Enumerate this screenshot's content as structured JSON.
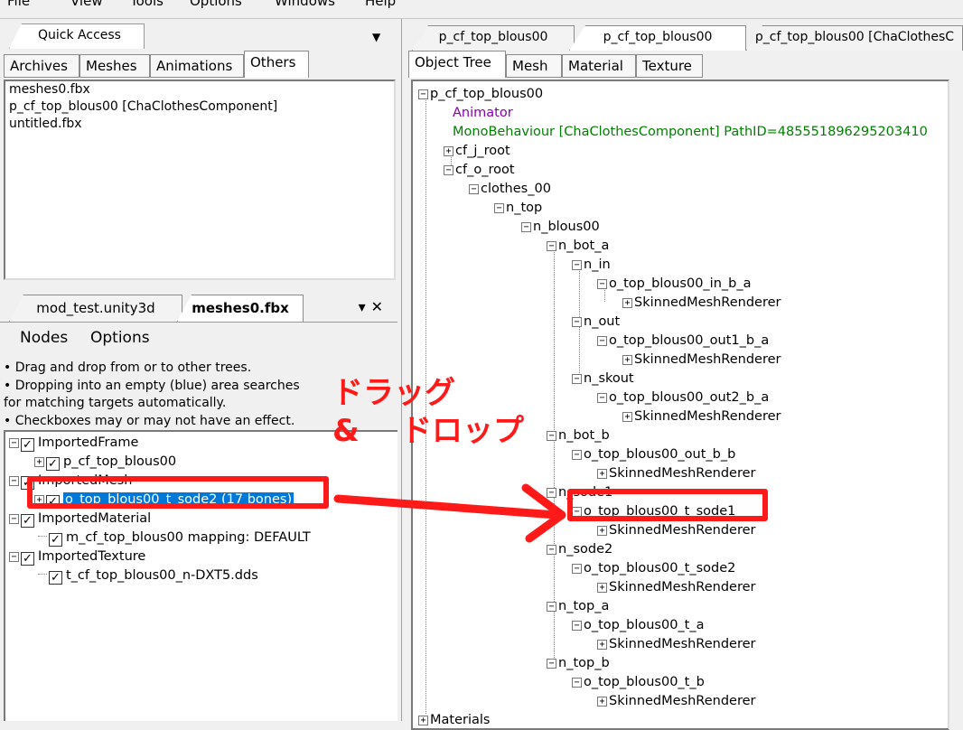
{
  "menu": {
    "file": "File",
    "view": "View",
    "tools": "Tools",
    "options": "Options",
    "windows": "Windows",
    "help": "Help"
  },
  "quick_access": {
    "title": "Quick Access",
    "tabs": [
      "Archives",
      "Meshes",
      "Animations",
      "Others"
    ],
    "items": [
      "meshes0.fbx",
      "p_cf_top_blous00 [ChaClothesComponent]",
      "untitled.fbx"
    ]
  },
  "lower_panel": {
    "tabs": [
      "mod_test.unity3d",
      "meshes0.fbx"
    ],
    "pin": "▾",
    "close": "✕",
    "menu": [
      "Nodes",
      "Options"
    ],
    "help": [
      "• Drag and drop from or to other trees.",
      "• Dropping into an empty (blue) area searches",
      "   for matching targets automatically.",
      "• Checkboxes may or may not have an effect."
    ],
    "tree": {
      "imported_frame": "ImportedFrame",
      "frame_child": "p_cf_top_blous00",
      "imported_mesh": "ImportedMesh",
      "mesh_child": "o_top_blous00_t_sode2 (17 bones)",
      "imported_material": "ImportedMaterial",
      "material_child": "m_cf_top_blous00 mapping: DEFAULT",
      "imported_texture": "ImportedTexture",
      "texture_child": "t_cf_top_blous00_n-DXT5.dds"
    }
  },
  "right_panel": {
    "tabs": [
      "p_cf_top_blous00",
      "p_cf_top_blous00",
      "p_cf_top_blous00 [ChaClothesC"
    ],
    "subtabs": [
      "Object Tree",
      "Mesh",
      "Material",
      "Texture"
    ],
    "tree": {
      "root": "p_cf_top_blous00",
      "animator": "Animator",
      "mono": "MonoBehaviour [ChaClothesComponent] PathID=485551896295203410",
      "cf_j_root": "cf_j_root",
      "cf_o_root": "cf_o_root",
      "clothes_00": "clothes_00",
      "n_top": "n_top",
      "n_blous00": "n_blous00",
      "n_bot_a": "n_bot_a",
      "n_in": "n_in",
      "in_b_a": "o_top_blous00_in_b_a",
      "smr": "SkinnedMeshRenderer",
      "n_out": "n_out",
      "out1_b_a": "o_top_blous00_out1_b_a",
      "n_skout": "n_skout",
      "out2_b_a": "o_top_blous00_out2_b_a",
      "n_bot_b": "n_bot_b",
      "out_b_b": "o_top_blous00_out_b_b",
      "n_sode1": "n_sode1",
      "t_sode1": "o_top_blous00_t_sode1",
      "n_sode2": "n_sode2",
      "t_sode2": "o_top_blous00_t_sode2",
      "n_top_a": "n_top_a",
      "t_a": "o_top_blous00_t_a",
      "n_top_b": "n_top_b",
      "t_b": "o_top_blous00_t_b",
      "materials": "Materials"
    }
  },
  "annotation": {
    "line1": "ドラッグ",
    "amp": "&",
    "line2": "ドロップ",
    "color": "#ff1a1a"
  }
}
